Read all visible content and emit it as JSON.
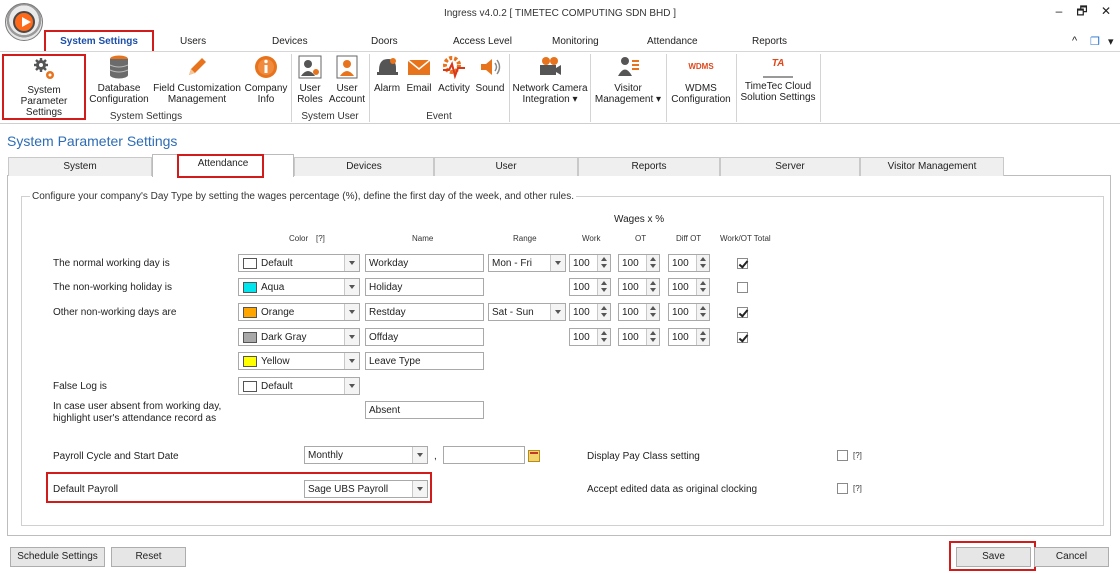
{
  "window": {
    "title": "Ingress v4.0.2 [ TIMETEC COMPUTING SDN BHD ]",
    "minimize": "–",
    "restore": "🗗",
    "close": "✕"
  },
  "menu": {
    "tabs": [
      "System Settings",
      "Users",
      "Devices",
      "Doors",
      "Access Level",
      "Monitoring",
      "Attendance",
      "Reports"
    ],
    "active": "System Settings",
    "right_controls": [
      "^",
      "❐",
      "▾"
    ]
  },
  "ribbon": {
    "groups": [
      {
        "label": "System Settings",
        "buttons": [
          {
            "label": "System Parameter Settings",
            "line1": "System Parameter",
            "line2": "Settings",
            "icon": "gears-icon"
          },
          {
            "label": "Database Configuration",
            "line1": "Database",
            "line2": "Configuration",
            "icon": "database-icon"
          },
          {
            "label": "Field Customization Management",
            "line1": "Field Customization",
            "line2": "Management",
            "icon": "pencil-icon"
          },
          {
            "label": "Company Info",
            "line1": "Company",
            "line2": "Info",
            "icon": "info-icon"
          }
        ]
      },
      {
        "label": "System User",
        "buttons": [
          {
            "label": "User Roles",
            "line1": "User",
            "line2": "Roles",
            "icon": "user-roles-icon"
          },
          {
            "label": "User Account",
            "line1": "User",
            "line2": "Account",
            "icon": "user-account-icon"
          }
        ]
      },
      {
        "label": "Event",
        "buttons": [
          {
            "label": "Alarm",
            "line1": "Alarm",
            "line2": "",
            "icon": "alarm-icon"
          },
          {
            "label": "Email",
            "line1": "Email",
            "line2": "",
            "icon": "email-icon"
          },
          {
            "label": "Activity",
            "line1": "Activity",
            "line2": "",
            "icon": "activity-icon"
          },
          {
            "label": "Sound",
            "line1": "Sound",
            "line2": "",
            "icon": "sound-icon"
          }
        ]
      },
      {
        "label": "",
        "buttons": [
          {
            "label": "Network Camera Integration",
            "line1": "Network Camera",
            "line2": "Integration ▾",
            "icon": "camera-icon"
          }
        ]
      },
      {
        "label": "",
        "buttons": [
          {
            "label": "Visitor Management",
            "line1": "Visitor",
            "line2": "Management ▾",
            "icon": "visitor-icon"
          }
        ]
      },
      {
        "label": "",
        "buttons": [
          {
            "label": "WDMS Configuration",
            "line1": "WDMS",
            "line2": "Configuration",
            "icon": "wdms-icon",
            "icon_text": "WDMS"
          }
        ]
      },
      {
        "label": "",
        "buttons": [
          {
            "label": "TimeTec Cloud Solution Settings",
            "line1": "TimeTec Cloud",
            "line2": "Solution Settings",
            "icon": "timetec-cloud-icon",
            "icon_text": "TA"
          }
        ]
      }
    ]
  },
  "page": {
    "title": "System Parameter Settings",
    "tabs": [
      "System",
      "Attendance",
      "Devices",
      "User",
      "Reports",
      "Server",
      "Visitor Management"
    ],
    "active_tab": "Attendance"
  },
  "attendance": {
    "description": "Configure your company's Day Type by setting the wages percentage (%), define the first day of the week, and other rules.",
    "wages_header": "Wages x %",
    "columns": {
      "color": "Color",
      "color_help": "[?]",
      "name": "Name",
      "range": "Range",
      "work": "Work",
      "ot": "OT",
      "diff_ot": "Diff OT",
      "work_ot_total": "Work/OT Total"
    },
    "rows": [
      {
        "label": "The normal working day is",
        "color": "Default",
        "swatch": "#ffffff",
        "name": "Workday",
        "range": "Mon - Fri",
        "work": "100",
        "ot": "100",
        "diff_ot": "100",
        "total": true
      },
      {
        "label": "The non-working holiday is",
        "color": "Aqua",
        "swatch": "#00e5ee",
        "name": "Holiday",
        "range": "",
        "work": "100",
        "ot": "100",
        "diff_ot": "100",
        "total": false
      },
      {
        "label": "Other non-working days are",
        "color": "Orange",
        "swatch": "#ffa500",
        "name": "Restday",
        "range": "Sat - Sun",
        "work": "100",
        "ot": "100",
        "diff_ot": "100",
        "total": true
      },
      {
        "label": "",
        "color": "Dark Gray",
        "swatch": "#a9a9a9",
        "name": "Offday",
        "range": "",
        "work": "100",
        "ot": "100",
        "diff_ot": "100",
        "total": true
      },
      {
        "label": "",
        "color": "Yellow",
        "swatch": "#ffff00",
        "name": "Leave Type"
      }
    ],
    "false_log": {
      "label": "False Log is",
      "color": "Default",
      "swatch": "#ffffff"
    },
    "absent": {
      "label_line1": "In case user absent from working day,",
      "label_line2": "highlight user's attendance record as",
      "value": "Absent"
    },
    "payroll_cycle": {
      "label": "Payroll Cycle and Start Date",
      "value": "Monthly",
      "separator": ",",
      "start_date": ""
    },
    "default_payroll": {
      "label": "Default Payroll",
      "value": "Sage UBS Payroll"
    },
    "display_pay_class": {
      "label": "Display Pay Class setting",
      "checked": false,
      "help": "[?]"
    },
    "accept_edited": {
      "label": "Accept edited data as original clocking",
      "checked": false,
      "help": "[?]"
    }
  },
  "footer": {
    "schedule_settings": "Schedule Settings",
    "reset": "Reset",
    "save": "Save",
    "cancel": "Cancel"
  }
}
